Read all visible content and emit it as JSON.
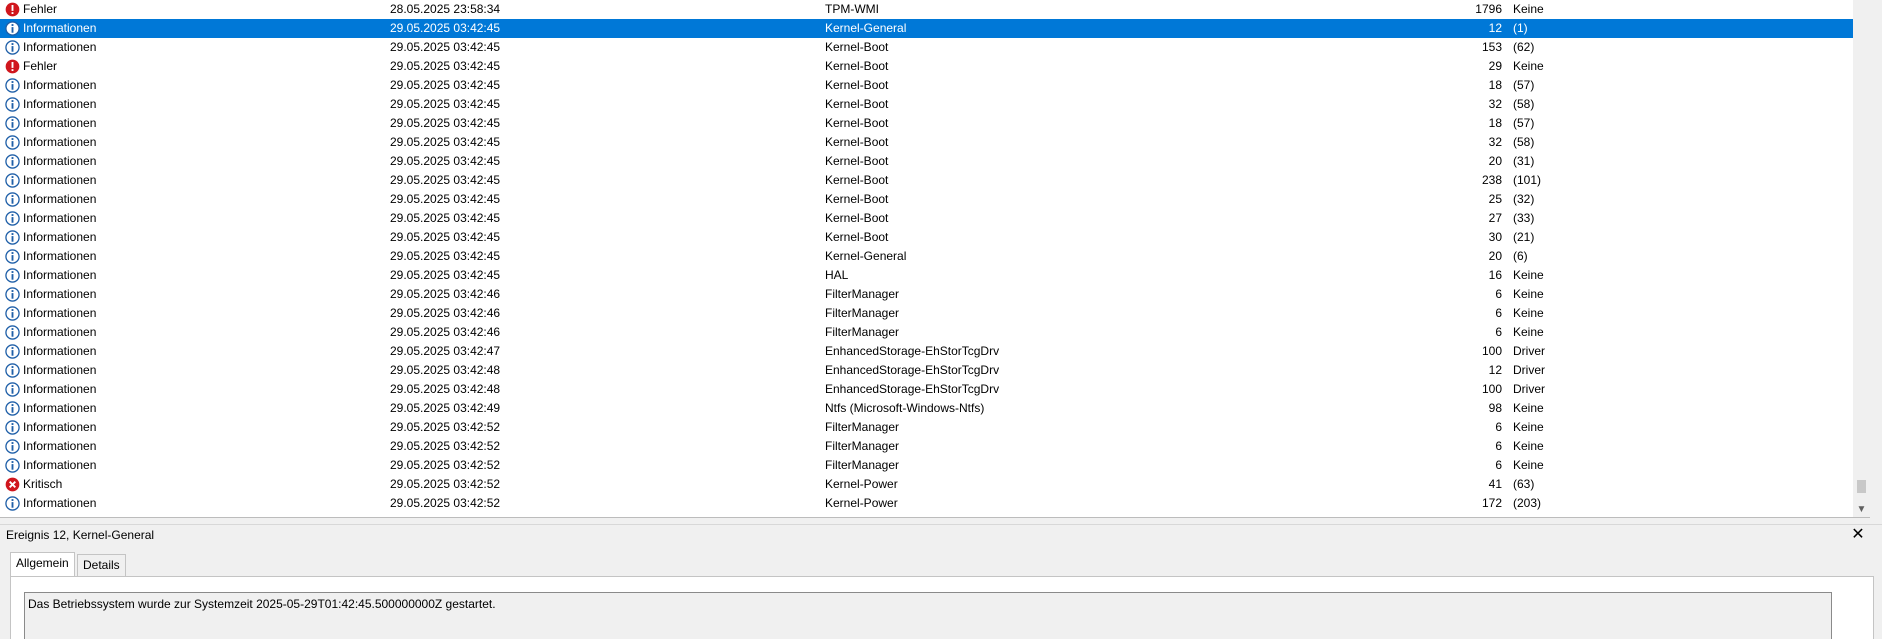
{
  "events": [
    {
      "level": "Fehler",
      "icon": "error",
      "date": "28.05.2025 23:58:34",
      "source": "TPM-WMI",
      "id": "1796",
      "task": "Keine"
    },
    {
      "level": "Informationen",
      "icon": "info",
      "date": "29.05.2025 03:42:45",
      "source": "Kernel-General",
      "id": "12",
      "task": "(1)",
      "selected": true
    },
    {
      "level": "Informationen",
      "icon": "info",
      "date": "29.05.2025 03:42:45",
      "source": "Kernel-Boot",
      "id": "153",
      "task": "(62)"
    },
    {
      "level": "Fehler",
      "icon": "error",
      "date": "29.05.2025 03:42:45",
      "source": "Kernel-Boot",
      "id": "29",
      "task": "Keine"
    },
    {
      "level": "Informationen",
      "icon": "info",
      "date": "29.05.2025 03:42:45",
      "source": "Kernel-Boot",
      "id": "18",
      "task": "(57)"
    },
    {
      "level": "Informationen",
      "icon": "info",
      "date": "29.05.2025 03:42:45",
      "source": "Kernel-Boot",
      "id": "32",
      "task": "(58)"
    },
    {
      "level": "Informationen",
      "icon": "info",
      "date": "29.05.2025 03:42:45",
      "source": "Kernel-Boot",
      "id": "18",
      "task": "(57)"
    },
    {
      "level": "Informationen",
      "icon": "info",
      "date": "29.05.2025 03:42:45",
      "source": "Kernel-Boot",
      "id": "32",
      "task": "(58)"
    },
    {
      "level": "Informationen",
      "icon": "info",
      "date": "29.05.2025 03:42:45",
      "source": "Kernel-Boot",
      "id": "20",
      "task": "(31)"
    },
    {
      "level": "Informationen",
      "icon": "info",
      "date": "29.05.2025 03:42:45",
      "source": "Kernel-Boot",
      "id": "238",
      "task": "(101)"
    },
    {
      "level": "Informationen",
      "icon": "info",
      "date": "29.05.2025 03:42:45",
      "source": "Kernel-Boot",
      "id": "25",
      "task": "(32)"
    },
    {
      "level": "Informationen",
      "icon": "info",
      "date": "29.05.2025 03:42:45",
      "source": "Kernel-Boot",
      "id": "27",
      "task": "(33)"
    },
    {
      "level": "Informationen",
      "icon": "info",
      "date": "29.05.2025 03:42:45",
      "source": "Kernel-Boot",
      "id": "30",
      "task": "(21)"
    },
    {
      "level": "Informationen",
      "icon": "info",
      "date": "29.05.2025 03:42:45",
      "source": "Kernel-General",
      "id": "20",
      "task": "(6)"
    },
    {
      "level": "Informationen",
      "icon": "info",
      "date": "29.05.2025 03:42:45",
      "source": "HAL",
      "id": "16",
      "task": "Keine"
    },
    {
      "level": "Informationen",
      "icon": "info",
      "date": "29.05.2025 03:42:46",
      "source": "FilterManager",
      "id": "6",
      "task": "Keine"
    },
    {
      "level": "Informationen",
      "icon": "info",
      "date": "29.05.2025 03:42:46",
      "source": "FilterManager",
      "id": "6",
      "task": "Keine"
    },
    {
      "level": "Informationen",
      "icon": "info",
      "date": "29.05.2025 03:42:46",
      "source": "FilterManager",
      "id": "6",
      "task": "Keine"
    },
    {
      "level": "Informationen",
      "icon": "info",
      "date": "29.05.2025 03:42:47",
      "source": "EnhancedStorage-EhStorTcgDrv",
      "id": "100",
      "task": "Driver"
    },
    {
      "level": "Informationen",
      "icon": "info",
      "date": "29.05.2025 03:42:48",
      "source": "EnhancedStorage-EhStorTcgDrv",
      "id": "12",
      "task": "Driver"
    },
    {
      "level": "Informationen",
      "icon": "info",
      "date": "29.05.2025 03:42:48",
      "source": "EnhancedStorage-EhStorTcgDrv",
      "id": "100",
      "task": "Driver"
    },
    {
      "level": "Informationen",
      "icon": "info",
      "date": "29.05.2025 03:42:49",
      "source": "Ntfs (Microsoft-Windows-Ntfs)",
      "id": "98",
      "task": "Keine"
    },
    {
      "level": "Informationen",
      "icon": "info",
      "date": "29.05.2025 03:42:52",
      "source": "FilterManager",
      "id": "6",
      "task": "Keine"
    },
    {
      "level": "Informationen",
      "icon": "info",
      "date": "29.05.2025 03:42:52",
      "source": "FilterManager",
      "id": "6",
      "task": "Keine"
    },
    {
      "level": "Informationen",
      "icon": "info",
      "date": "29.05.2025 03:42:52",
      "source": "FilterManager",
      "id": "6",
      "task": "Keine"
    },
    {
      "level": "Kritisch",
      "icon": "critical",
      "date": "29.05.2025 03:42:52",
      "source": "Kernel-Power",
      "id": "41",
      "task": "(63)"
    },
    {
      "level": "Informationen",
      "icon": "info",
      "date": "29.05.2025 03:42:52",
      "source": "Kernel-Power",
      "id": "172",
      "task": "(203)"
    }
  ],
  "icons": {
    "info": {
      "name": "info-icon",
      "color": "#1f5fa8"
    },
    "error": {
      "name": "error-icon",
      "color": "#d0161d"
    },
    "critical": {
      "name": "critical-icon",
      "color": "#d0161d"
    }
  },
  "selection_color": "#0078d7",
  "detail": {
    "title": "Ereignis 12, Kernel-General",
    "close_label": "✕",
    "tabs": [
      {
        "label": "Allgemein",
        "active": true
      },
      {
        "label": "Details",
        "active": false
      }
    ],
    "description": "Das Betriebssystem wurde zur Systemzeit 2025-05-29T01:42:45.500000000Z gestartet."
  }
}
